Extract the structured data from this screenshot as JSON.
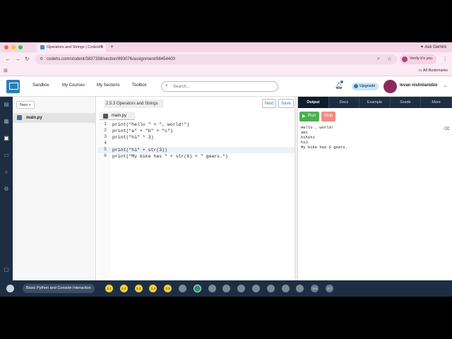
{
  "browser": {
    "tab_title": "Operators and Strings | CodeHS",
    "new_tab_icon": "+",
    "ask_gemini": "Ask Gemini",
    "url": "codehs.com/student/3837338/section/893076/assignment/98454400",
    "verify_label": "Verify it's you",
    "all_bookmarks": "All Bookmarks"
  },
  "header": {
    "nav": [
      "Sandbox",
      "My Courses",
      "My Sections",
      "Toolbox"
    ],
    "search_placeholder": "Search...",
    "upgrade_label": "Upgrade",
    "user_name": "levan nishnianidze",
    "caret": "⌄"
  },
  "files": {
    "new_label": "New +",
    "items": [
      "main.py"
    ]
  },
  "editor": {
    "assignment_title": "2.5.3 Operators and Strings",
    "next_label": "Next",
    "save_label": "Save",
    "file_tab": "main.py",
    "lines": [
      {
        "n": "1",
        "code": "print(\"hello \" + \", world!\")"
      },
      {
        "n": "2",
        "code": "print(\"a\" + \"b\" + \"c\")"
      },
      {
        "n": "3",
        "code": "print(\"hi\" * 3)"
      },
      {
        "n": "4",
        "code": ""
      },
      {
        "n": "5",
        "code": "print(\"hi\" + str(3))"
      },
      {
        "n": "6",
        "code": "print(\"My bike has \" + str(6) + \" gears.\")"
      }
    ]
  },
  "right_panel": {
    "tabs": [
      "Output",
      "Docs",
      "Example",
      "Grade",
      "More"
    ],
    "run_label": "Run",
    "stop_label": "Stop",
    "console_lines": [
      "Hello , world!",
      "abc",
      "hihihi",
      "hi3",
      "My bike has 6 gears."
    ]
  },
  "bottom_bar": {
    "breadcrumb": "Basic Python and Console Interaction",
    "pips": [
      "2.1",
      "2.2",
      "2.3",
      "2.4",
      "2.5",
      "",
      "",
      "",
      "",
      "",
      "",
      "",
      "",
      "",
      "2.6",
      "2.7"
    ]
  },
  "colors": {
    "accent": "#2a7fb8",
    "dark_nav": "#1e2e42",
    "run_green": "#4caf50",
    "stop_red": "#f28b82",
    "pip_yellow": "#f2d13b"
  }
}
